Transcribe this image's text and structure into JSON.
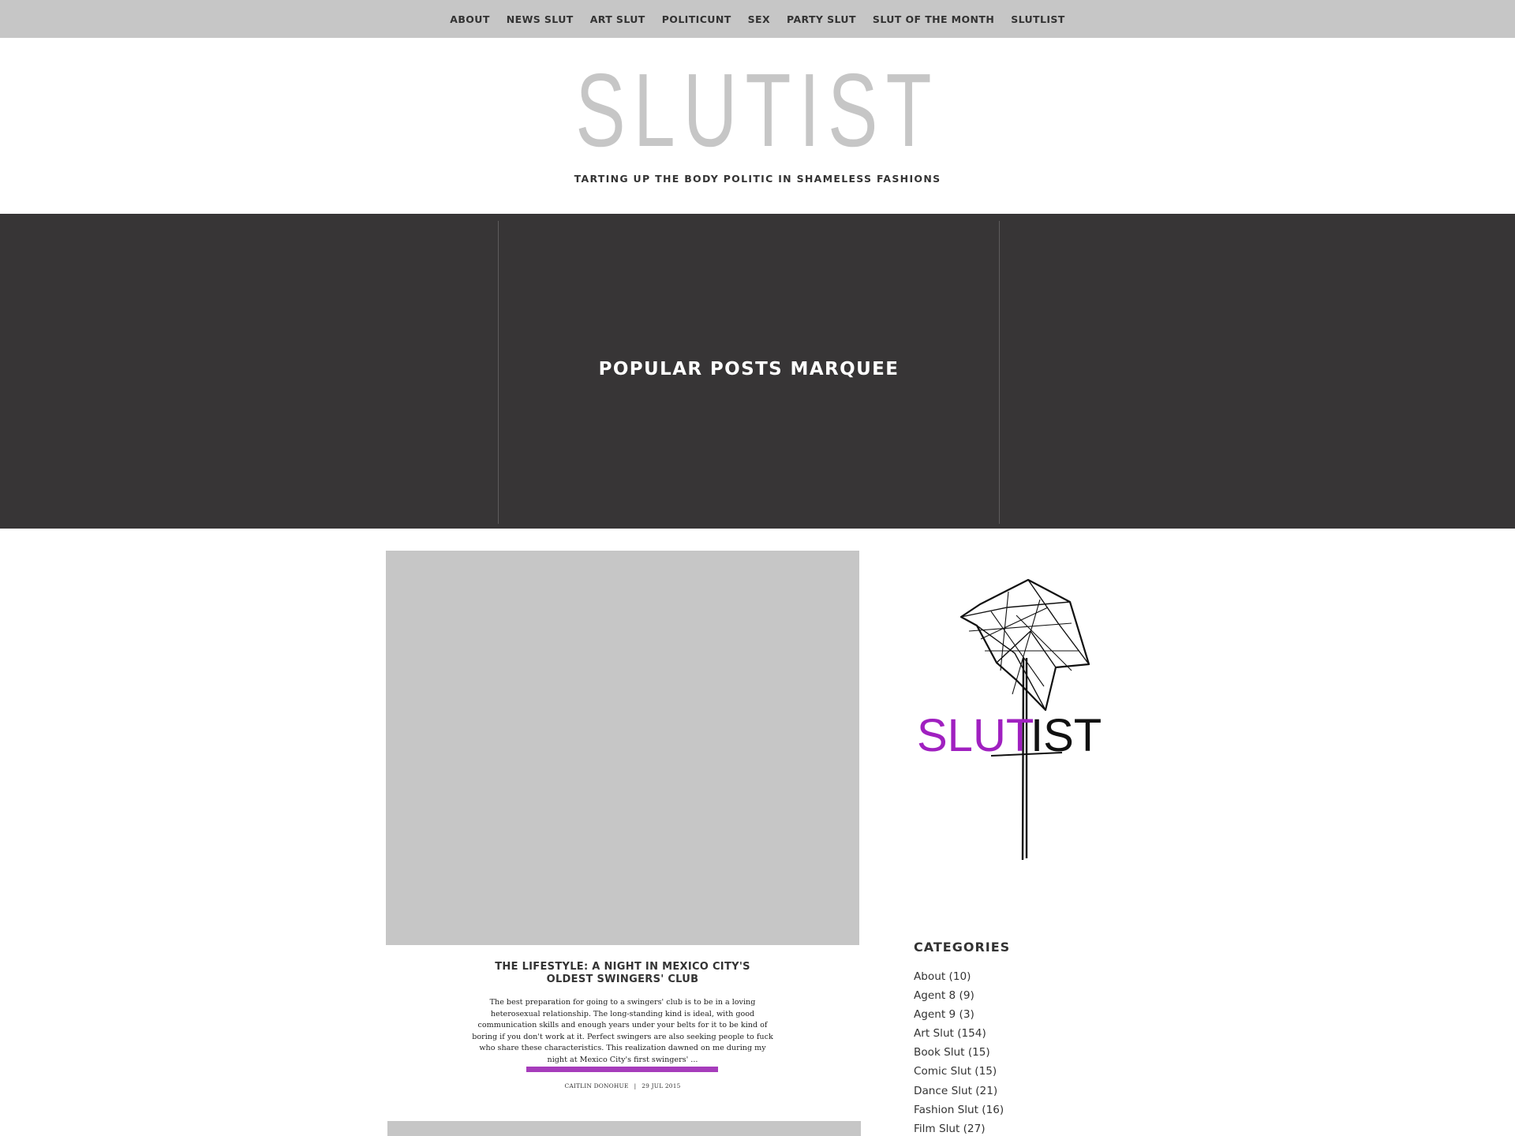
{
  "nav": {
    "items": [
      {
        "label": "ABOUT"
      },
      {
        "label": "NEWS SLUT"
      },
      {
        "label": "ART SLUT"
      },
      {
        "label": "POLITICUNT"
      },
      {
        "label": "SEX"
      },
      {
        "label": "PARTY SLUT"
      },
      {
        "label": "SLUT OF THE MONTH"
      },
      {
        "label": "SLUTLIST"
      }
    ]
  },
  "header": {
    "title": "SLUTIST",
    "tagline": "TARTING UP THE BODY POLITIC IN SHAMELESS FASHIONS"
  },
  "marquee": {
    "title": "POPULAR POSTS MARQUEE"
  },
  "post": {
    "title": "THE LIFESTYLE: A NIGHT IN MEXICO CITY'S OLDEST SWINGERS' CLUB",
    "excerpt": "The best preparation for going to a swingers' club is to be in a loving heterosexual relationship. The long-standing kind is ideal, with good communication skills and enough years under your belts for it to be kind of boring if you don't work at it. Perfect swingers are also seeking people to fuck who share these characteristics. This realization dawned on me during my night at Mexico City's first swingers' ...",
    "author": "CAITLIN DONOHUE",
    "separator": "|",
    "date": "29 JUL 2015"
  },
  "sidebar": {
    "logo": {
      "text_left": "SLUT",
      "text_right": "IST",
      "accent_color": "#a020c0"
    },
    "categories_heading": "CATEGORIES",
    "categories": [
      {
        "label": "About (10)"
      },
      {
        "label": "Agent 8 (9)"
      },
      {
        "label": "Agent 9 (3)"
      },
      {
        "label": "Art Slut (154)"
      },
      {
        "label": "Book Slut (15)"
      },
      {
        "label": "Comic Slut (15)"
      },
      {
        "label": "Dance Slut (21)"
      },
      {
        "label": "Fashion Slut (16)"
      },
      {
        "label": "Film Slut (27)"
      }
    ]
  },
  "colors": {
    "nav_bg": "#c6c6c6",
    "marquee_bg": "#373536",
    "accent": "#a63cbb",
    "placeholder": "#c6c6c6"
  }
}
